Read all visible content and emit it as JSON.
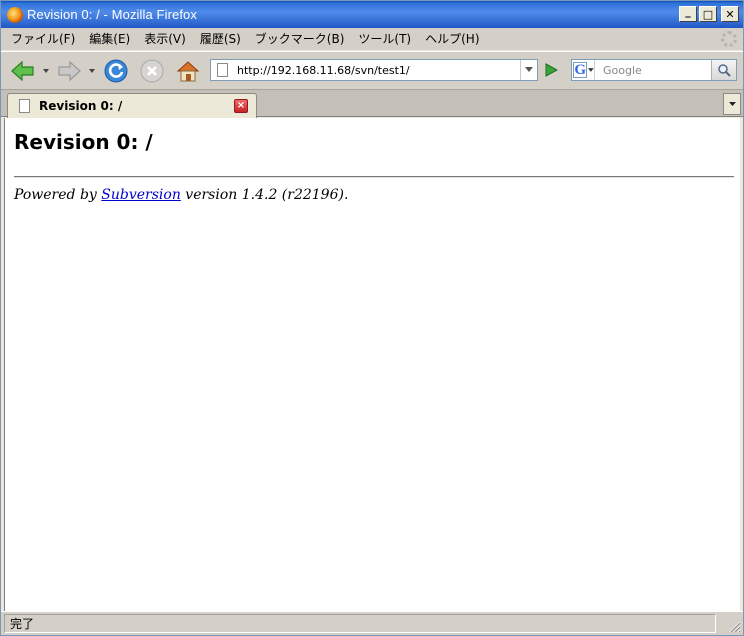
{
  "window": {
    "title": "Revision 0: / - Mozilla Firefox",
    "controls": {
      "minimize": "_",
      "maximize": "□",
      "close": "✕"
    }
  },
  "menubar": {
    "items": [
      {
        "label": "ファイル(F)"
      },
      {
        "label": "編集(E)"
      },
      {
        "label": "表示(V)"
      },
      {
        "label": "履歴(S)"
      },
      {
        "label": "ブックマーク(B)"
      },
      {
        "label": "ツール(T)"
      },
      {
        "label": "ヘルプ(H)"
      }
    ]
  },
  "navbar": {
    "url": "http://192.168.11.68/svn/test1/",
    "search_placeholder": "Google",
    "icons": [
      "back-arrow-icon",
      "forward-arrow-icon",
      "reload-icon",
      "stop-icon",
      "home-icon",
      "go-arrow-icon",
      "google-engine-icon",
      "magnifier-icon"
    ],
    "colors": {
      "back": "#4caf3a",
      "reload": "#3a86d9",
      "go": "#2f9a2f"
    }
  },
  "tabs": {
    "items": [
      {
        "label": "Revision 0: /",
        "active": true
      }
    ],
    "close_glyph": "×"
  },
  "page": {
    "heading": "Revision 0: /",
    "footer": {
      "prefix": "Powered by ",
      "link_text": "Subversion",
      "suffix": " version 1.4.2 (r22196)."
    },
    "link_color": "#0000cc"
  },
  "statusbar": {
    "text": "完了"
  }
}
